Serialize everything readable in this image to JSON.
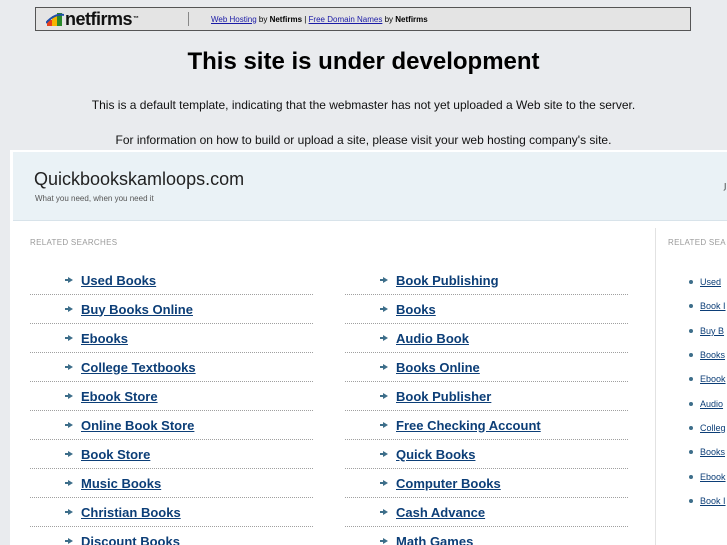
{
  "netfirms_bar": {
    "logo_text": "netfirms",
    "logo_trademark": "™",
    "link_hosting": "Web Hosting",
    "by1": " by ",
    "brand1": "Netfirms",
    "pipe": " | ",
    "link_domains": "Free Domain Names",
    "by2": " by ",
    "brand2": "Netfirms"
  },
  "headline": "This site is under development",
  "paragraph1": "This is a default template, indicating that the webmaster has not yet uploaded a Web site to the server.",
  "paragraph2": "For information on how to build or upload a site, please visit your web hosting company's site.",
  "parked": {
    "site_title": "Quickbookskamloops.com",
    "tagline": "What you need, when you need it",
    "header_right": "J",
    "related_label": "RELATED SEARCHES",
    "side_related_label": "RELATED SEA",
    "left_links": [
      "Used Books",
      "Buy Books Online",
      "Ebooks",
      "College Textbooks",
      "Ebook Store",
      "Online Book Store",
      "Book Store",
      "Music Books",
      "Christian Books",
      "Discount Books"
    ],
    "right_links": [
      "Book Publishing",
      "Books",
      "Audio Book",
      "Books Online",
      "Book Publisher",
      "Free Checking Account",
      "Quick Books",
      "Computer Books",
      "Cash Advance",
      "Math Games"
    ],
    "side_links": [
      "Used",
      "Book I",
      "Buy B",
      "Books",
      "Ebook",
      "Audio",
      "Colleg",
      "Books",
      "Ebook",
      "Book I"
    ]
  },
  "colors": {
    "page_bg": "#e9ebee",
    "header_bg": "#eaf2f6",
    "link": "#0c3e77",
    "arrow": "#3d6e8a"
  }
}
